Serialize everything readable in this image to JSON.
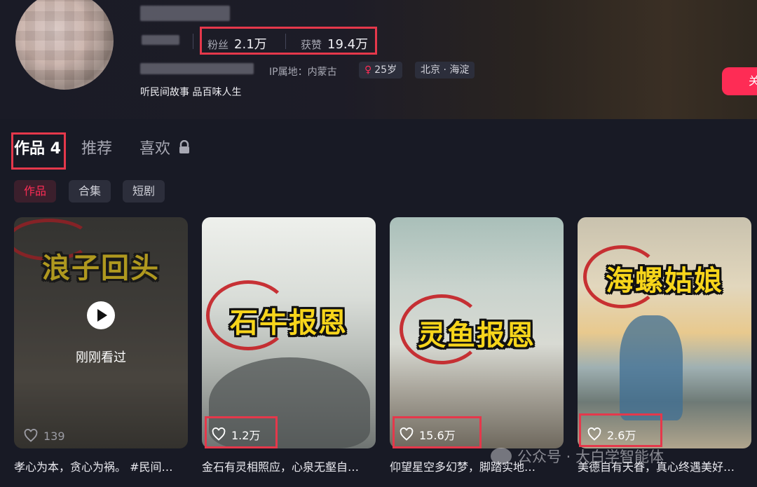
{
  "profile": {
    "stats": {
      "fans_label": "粉丝",
      "fans_value": "2.1万",
      "likes_label": "获赞",
      "likes_value": "19.4万"
    },
    "ip_location": "IP属地：内蒙古",
    "age_chip": "25岁",
    "city_chip": "北京 · 海淀",
    "bio": "听民间故事 品百味人生",
    "follow_label": "关"
  },
  "tabs": [
    {
      "label": "作品 4",
      "active": true
    },
    {
      "label": "推荐",
      "active": false
    },
    {
      "label": "喜欢",
      "active": false,
      "locked": true
    }
  ],
  "subtabs": [
    {
      "label": "作品",
      "active": true
    },
    {
      "label": "合集",
      "active": false
    },
    {
      "label": "短剧",
      "active": false
    }
  ],
  "videos": [
    {
      "art_title": "浪子回头",
      "likes": "139",
      "watched_label": "刚刚看过",
      "caption": "孝心为本，贪心为祸。 #民间…"
    },
    {
      "art_title": "石牛报恩",
      "likes": "1.2万",
      "caption": "金石有灵相照应，心泉无壑自…"
    },
    {
      "art_title": "灵鱼报恩",
      "likes": "15.6万",
      "caption": "仰望星空多幻梦，脚踏实地…"
    },
    {
      "art_title": "海螺姑娘",
      "likes": "2.6万",
      "caption": "美德自有天眷，真心终遇美好…"
    }
  ],
  "watermark": "公众号 · 大白学智能体",
  "colors": {
    "accent": "#fe2c55",
    "highlight_box": "#e5384b",
    "background": "#181a25"
  }
}
